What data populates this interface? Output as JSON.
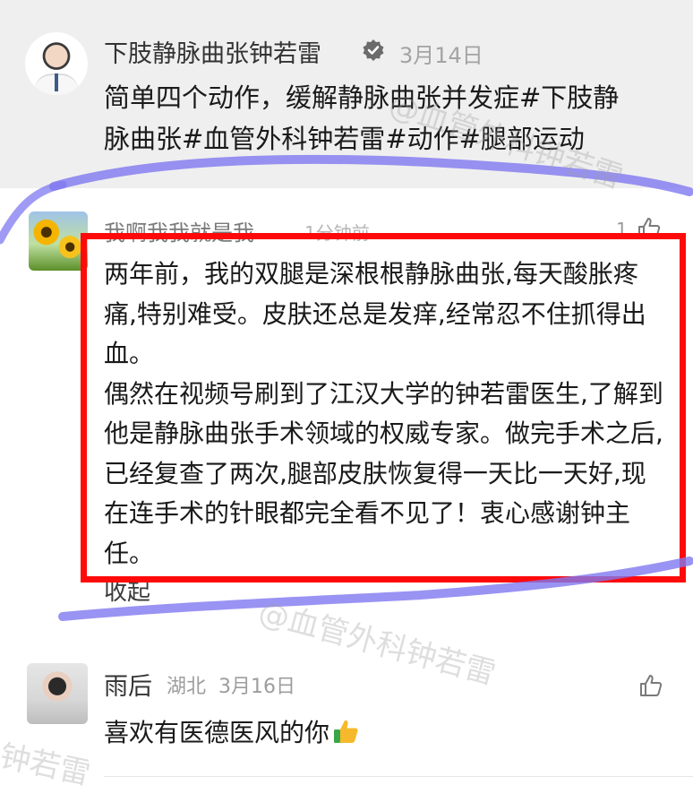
{
  "post": {
    "author": "下肢静脉曲张钟若雷",
    "date": "3月14日",
    "text": "简单四个动作，缓解静脉曲张并发症#下肢静脉曲张#血管外科钟若雷#动作#腿部运动"
  },
  "comment1": {
    "author": "我啊我我就是我",
    "time": "1分钟前",
    "likes": "1",
    "text": "两年前，我的双腿是深根根静脉曲张,每天酸胀疼痛,特别难受。皮肤还总是发痒,经常忍不住抓得出血。\n偶然在视频号刷到了江汉大学的钟若雷医生,了解到他是静脉曲张手术领域的权威专家。做完手术之后,已经复查了两次,腿部皮肤恢复得一天比一天好,现在连手术的针眼都完全看不见了！衷心感谢钟主任。",
    "collapse": "收起"
  },
  "comment2": {
    "author": "雨后",
    "location": "湖北",
    "date": "3月16日",
    "text": "喜欢有医德医风的你"
  },
  "watermark": "@血管外科钟若雷",
  "watermark_short": "钟若雷",
  "colors": {
    "highlight_box": "#ff0a0a",
    "scribble": "#7f78f0",
    "header_bg": "#efefef"
  }
}
